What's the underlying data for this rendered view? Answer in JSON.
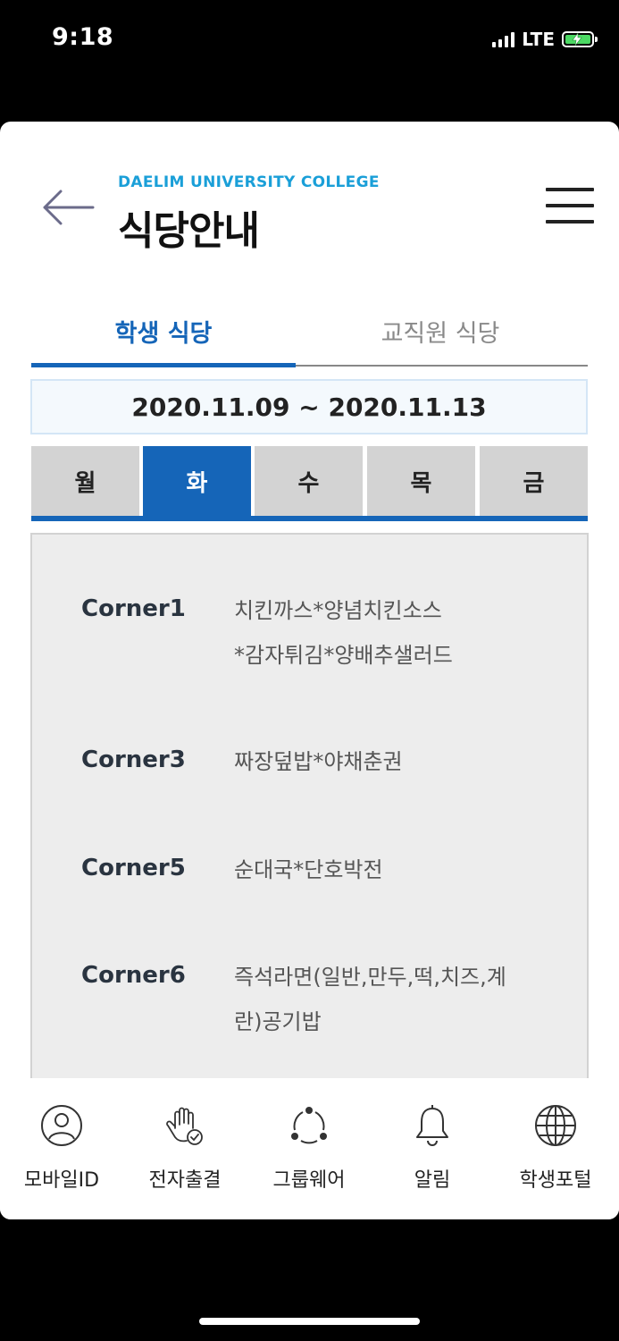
{
  "status_bar": {
    "time": "9:18",
    "network": "LTE"
  },
  "header": {
    "brand": "DAELIM UNIVERSITY COLLEGE",
    "title": "식당안내"
  },
  "tabs": [
    {
      "label": "학생 식당",
      "active": true
    },
    {
      "label": "교직원 식당",
      "active": false
    }
  ],
  "date_range": "2020.11.09 ~ 2020.11.13",
  "days": [
    {
      "label": "월",
      "active": false
    },
    {
      "label": "화",
      "active": true
    },
    {
      "label": "수",
      "active": false
    },
    {
      "label": "목",
      "active": false
    },
    {
      "label": "금",
      "active": false
    }
  ],
  "menu": [
    {
      "corner": "Corner1",
      "dishes": "치킨까스*양념치킨소스\n*감자튀김*양배추샐러드"
    },
    {
      "corner": "Corner3",
      "dishes": "짜장덮밥*야채춘권"
    },
    {
      "corner": "Corner5",
      "dishes": "순대국*단호박전"
    },
    {
      "corner": "Corner6",
      "dishes": "즉석라면(일반,만두,떡,치즈,계\n란)공기밥"
    }
  ],
  "bottom_nav": [
    {
      "label": "모바일ID",
      "icon": "person-icon"
    },
    {
      "label": "전자출결",
      "icon": "hand-check-icon"
    },
    {
      "label": "그룹웨어",
      "icon": "group-cycle-icon"
    },
    {
      "label": "알림",
      "icon": "bell-icon"
    },
    {
      "label": "학생포털",
      "icon": "globe-icon"
    }
  ],
  "colors": {
    "accent": "#1565b8",
    "brand": "#1a9fd8",
    "panel": "#ededed",
    "battery": "#4cd964"
  }
}
